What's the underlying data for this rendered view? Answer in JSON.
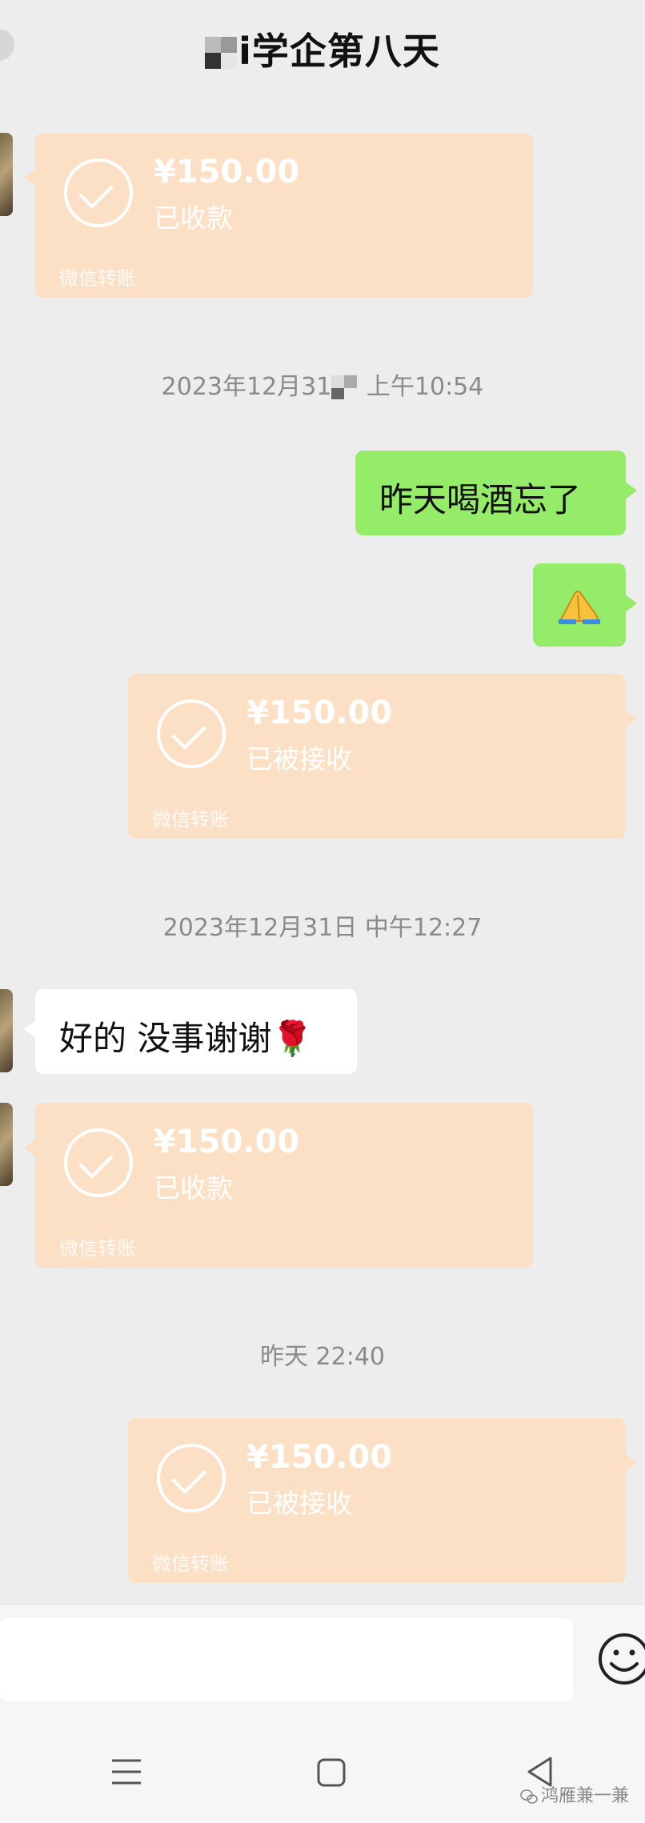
{
  "header": {
    "title": "i学企第八天"
  },
  "messages": {
    "card1": {
      "amount": "¥150.00",
      "status": "已收款",
      "footer": "微信转账"
    },
    "time1": {
      "before": "2023年12月31",
      "after": "上午10:54"
    },
    "msg1": {
      "text": "昨天喝酒忘了"
    },
    "card2": {
      "amount": "¥150.00",
      "status": "已被接收",
      "footer": "微信转账"
    },
    "time2": {
      "text": "2023年12月31日 中午12:27"
    },
    "msg3": {
      "text": "好的 没事谢谢🌹"
    },
    "card3": {
      "amount": "¥150.00",
      "status": "已收款",
      "footer": "微信转账"
    },
    "time3": {
      "text": "昨天 22:40"
    },
    "card4": {
      "amount": "¥150.00",
      "status": "已被接收",
      "footer": "微信转账"
    }
  },
  "watermark": {
    "text": "鸿雁兼一兼"
  }
}
